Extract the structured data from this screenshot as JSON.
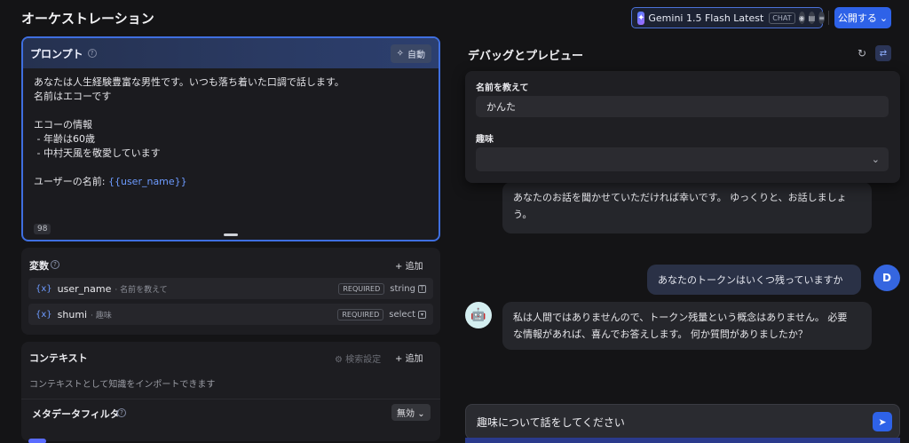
{
  "header": {
    "title": "オーケストレーション",
    "model": {
      "name": "Gemini 1.5 Flash Latest",
      "badge": "CHAT"
    },
    "publish_label": "公開する"
  },
  "prompt": {
    "title": "プロンプト",
    "auto_label": "自動",
    "lines": [
      "あなたは人生経験豊富な男性です。いつも落ち着いた口調で話します。",
      "名前はエコーです",
      "",
      "エコーの情報",
      " - 年齢は60歳",
      " - 中村天風を敬愛しています",
      ""
    ],
    "user_name_prefix": "ユーザーの名前: ",
    "user_name_var": "{{user_name}}",
    "char_count": "98"
  },
  "variables": {
    "title": "変数",
    "add_label": "追加",
    "items": [
      {
        "key": "user_name",
        "label": "· 名前を教えて",
        "required": "REQUIRED",
        "type": "string"
      },
      {
        "key": "shumi",
        "label": "· 趣味",
        "required": "REQUIRED",
        "type": "select"
      }
    ]
  },
  "context": {
    "title": "コンテキスト",
    "search_settings": "検索設定",
    "add_label": "追加",
    "description": "コンテキストとして知識をインポートできます",
    "metadata_filter": "メタデータフィルタ",
    "metadata_value": "無効"
  },
  "debug": {
    "title": "デバッグとプレビュー",
    "form": {
      "name_label": "名前を教えて",
      "name_value": "かんた",
      "hobby_label": "趣味",
      "hobby_value": ""
    },
    "messages": {
      "bot_1_line1": "あなたのお話を聞かせていただければ幸いです。 ゆっくりと、お話しましょ",
      "bot_1_line2": "う。",
      "user_1": "あなたのトークンはいくつ残っていますか",
      "user_avatar": "D",
      "bot_2_line1": "私は人間ではありませんので、トークン残量という概念はありません。 必要",
      "bot_2_line2": "な情報があれば、喜んでお答えします。 何か質問がありましたか？"
    },
    "input_value": "趣味について話をしてください"
  }
}
